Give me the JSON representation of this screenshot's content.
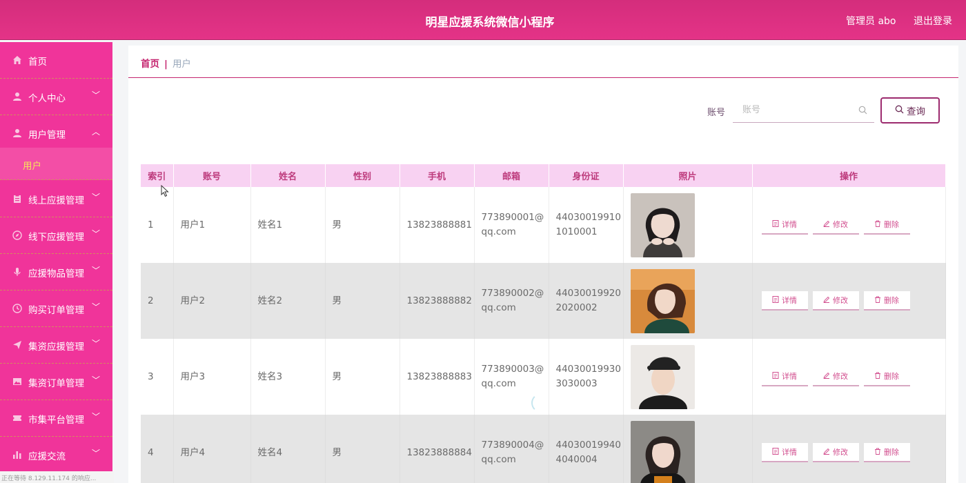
{
  "header": {
    "title": "明星应援系统微信小程序",
    "user": "管理员 abo",
    "logout": "退出登录"
  },
  "sidebar": {
    "items": [
      {
        "label": "首页",
        "icon": "home-icon"
      },
      {
        "label": "个人中心",
        "icon": "person-icon"
      },
      {
        "label": "用户管理",
        "icon": "person-icon"
      },
      {
        "label": "用户",
        "icon": ""
      },
      {
        "label": "线上应援管理",
        "icon": "clipboard-icon"
      },
      {
        "label": "线下应援管理",
        "icon": "compass-icon"
      },
      {
        "label": "应援物品管理",
        "icon": "mic-icon"
      },
      {
        "label": "购买订单管理",
        "icon": "clock-icon"
      },
      {
        "label": "集资应援管理",
        "icon": "send-icon"
      },
      {
        "label": "集资订单管理",
        "icon": "picture-icon"
      },
      {
        "label": "市集平台管理",
        "icon": "ticket-icon"
      },
      {
        "label": "应援交流",
        "icon": "bar-chart-icon"
      }
    ],
    "status": "正在等待 8.129.11.174 的响应..."
  },
  "breadcrumb": {
    "home": "首页",
    "sep": "|",
    "current": "用户"
  },
  "search": {
    "label": "账号",
    "placeholder": "账号",
    "button": "查询"
  },
  "table": {
    "columns": [
      "索引",
      "账号",
      "姓名",
      "性别",
      "手机",
      "邮箱",
      "身份证",
      "照片",
      "操作"
    ],
    "rows": [
      {
        "index": "1",
        "account": "用户1",
        "name": "姓名1",
        "gender": "男",
        "phone": "13823888881",
        "email": "773890001@qq.com",
        "id_card": "440300199101010001"
      },
      {
        "index": "2",
        "account": "用户2",
        "name": "姓名2",
        "gender": "男",
        "phone": "13823888882",
        "email": "773890002@qq.com",
        "id_card": "440300199202020002"
      },
      {
        "index": "3",
        "account": "用户3",
        "name": "姓名3",
        "gender": "男",
        "phone": "13823888883",
        "email": "773890003@qq.com",
        "id_card": "440300199303030003"
      },
      {
        "index": "4",
        "account": "用户4",
        "name": "姓名4",
        "gender": "男",
        "phone": "13823888884",
        "email": "773890004@qq.com",
        "id_card": "440300199404040004"
      }
    ],
    "actions": {
      "detail": "详情",
      "edit": "修改",
      "delete": "删除"
    }
  },
  "colors": {
    "header": "#e43387",
    "sidebar": "#f0349a",
    "accent": "#c4246e",
    "table_header": "#f8d2f2"
  }
}
